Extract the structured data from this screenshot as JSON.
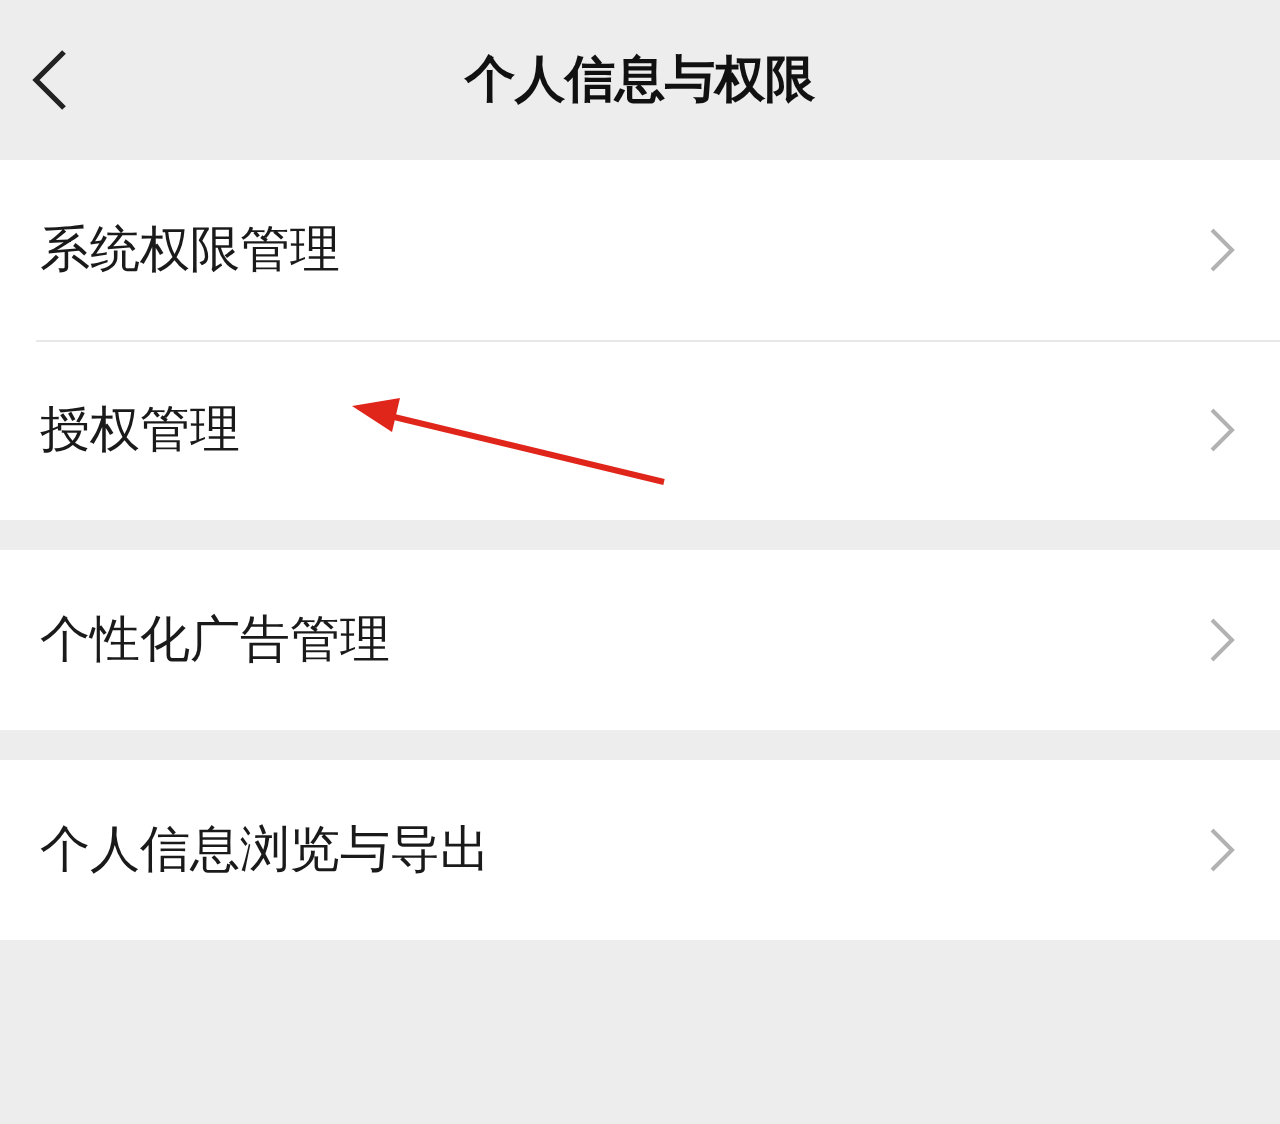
{
  "header": {
    "title": "个人信息与权限"
  },
  "groups": [
    {
      "items": [
        {
          "label": "系统权限管理"
        },
        {
          "label": "授权管理"
        }
      ]
    },
    {
      "items": [
        {
          "label": "个性化广告管理"
        }
      ]
    },
    {
      "items": [
        {
          "label": "个人信息浏览与导出"
        }
      ]
    }
  ]
}
